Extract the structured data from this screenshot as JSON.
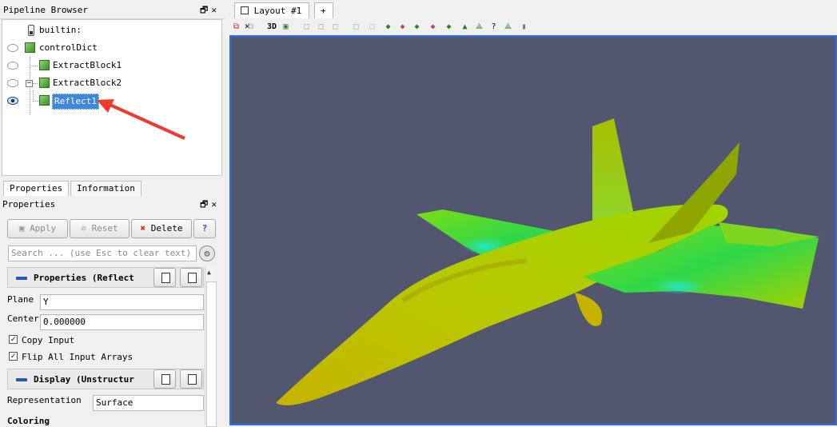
{
  "pipeline": {
    "title": "Pipeline Browser",
    "dock_buttons": "🗗✕",
    "items": [
      {
        "label": "builtin:"
      },
      {
        "label": "controlDict"
      },
      {
        "label": "ExtractBlock1"
      },
      {
        "label": "ExtractBlock2"
      },
      {
        "label": "Reflect1",
        "selected": true
      }
    ],
    "collapse_glyph": "−"
  },
  "tabs_left": [
    "Properties",
    "Information"
  ],
  "properties": {
    "title": "Properties",
    "dock_buttons": "🗗✕",
    "apply": "Apply",
    "reset": "Reset",
    "delete": "Delete",
    "help": "?",
    "search_placeholder": "Search ... (use Esc to clear text)",
    "section1": "Properties (Reflect",
    "plane_label": "Plane",
    "plane_value": "Y",
    "center_label": "Center",
    "center_value": "0.000000",
    "copy_input_label": "Copy Input",
    "flip_label": "Flip All Input Arrays",
    "check_glyph": "✓",
    "section2": "Display (Unstructur",
    "representation_label": "Representation",
    "representation_value": "Surface",
    "coloring_label": "Coloring"
  },
  "view": {
    "tab_label": "Layout #1",
    "close_glyph": "✕",
    "add_tab": "+",
    "toolbar_3d": "3D",
    "background_color": "#52566e"
  },
  "annotation": {
    "color": "#f03a2e"
  }
}
